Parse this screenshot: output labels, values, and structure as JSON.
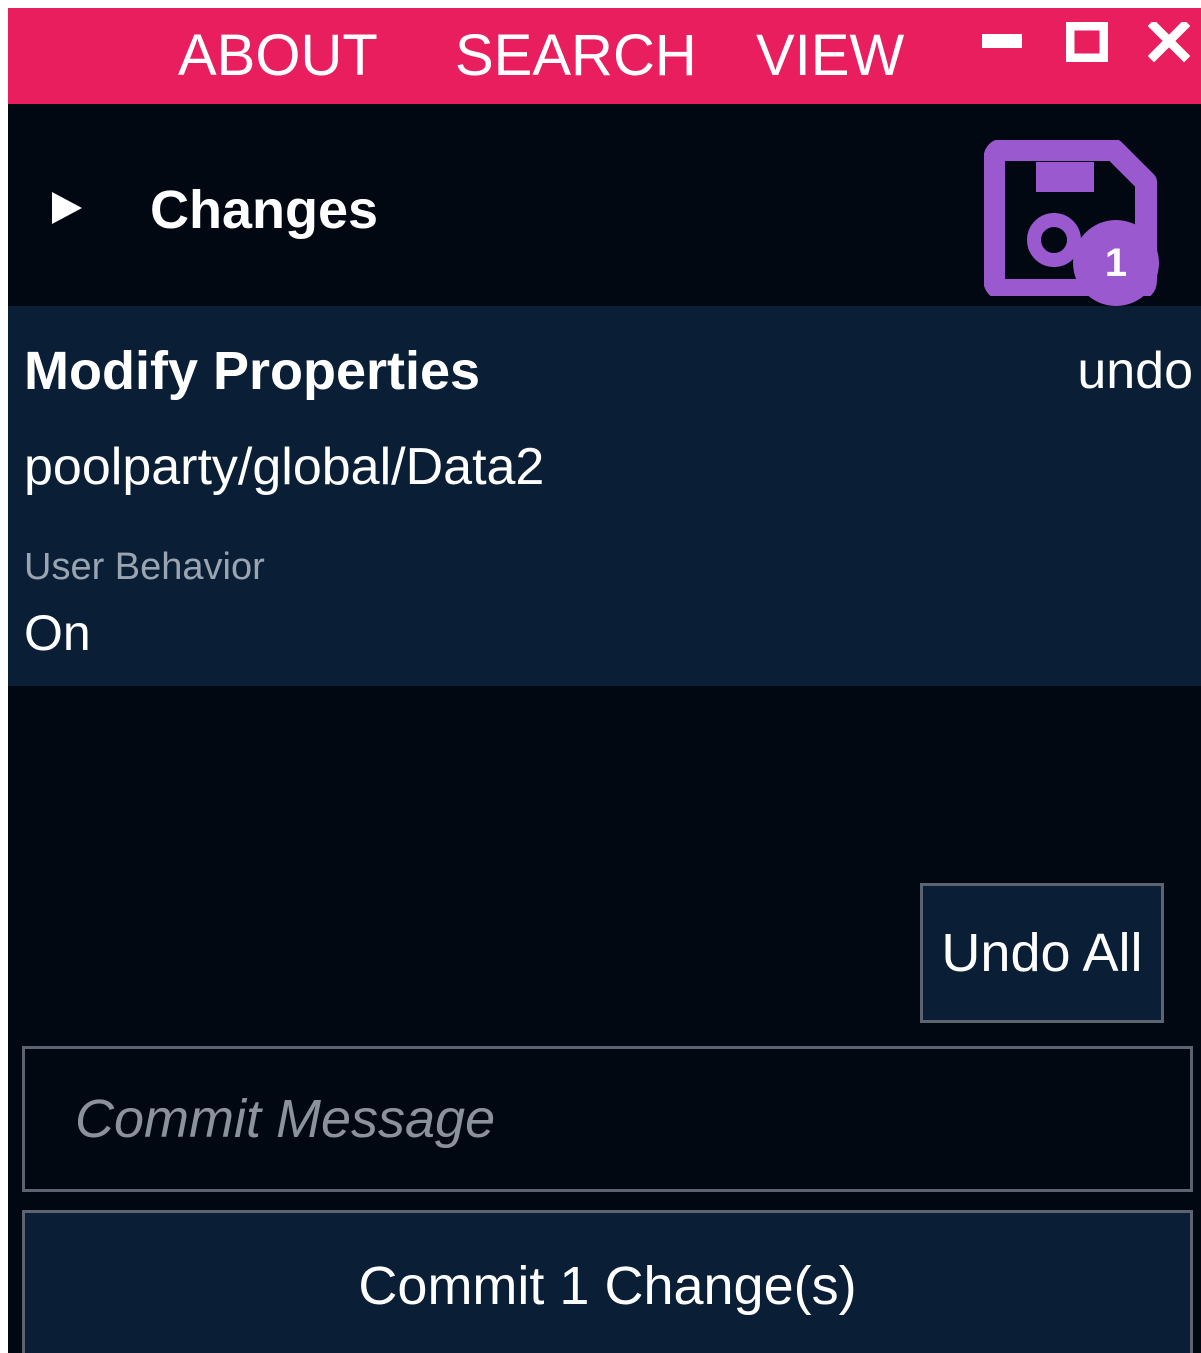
{
  "menu": {
    "items": [
      "ABOUT",
      "SEARCH",
      "VIEW"
    ]
  },
  "window_controls": {
    "minimize": "minimize-icon",
    "maximize": "maximize-icon",
    "close": "close-icon"
  },
  "changes": {
    "title": "Changes",
    "pending_count": "1",
    "entry": {
      "action": "Modify Properties",
      "undo_label": "undo",
      "path": "poolparty/global/Data2",
      "property_name": "User Behavior",
      "property_value": "On"
    },
    "undo_all_label": "Undo All"
  },
  "commit": {
    "message_value": "",
    "message_placeholder": "Commit Message",
    "button_label": "Commit 1 Change(s)"
  },
  "colors": {
    "menubar": "#e91e5f",
    "background": "#020812",
    "card": "#0a1f36",
    "accent": "#9b59d0"
  }
}
